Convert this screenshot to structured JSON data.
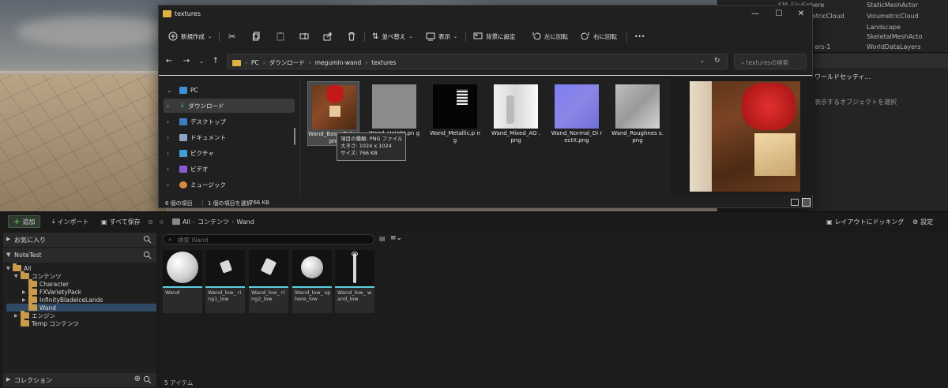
{
  "explorer": {
    "title": "textures",
    "commands": {
      "new": "新規作成",
      "sort": "並べ替え",
      "view": "表示",
      "set_background": "背景に設定",
      "rotate_left": "左に回転",
      "rotate_right": "右に回転",
      "more": "•••"
    },
    "path": [
      "PC",
      "ダウンロード",
      "megumin-wand",
      "textures"
    ],
    "search_placeholder": "texturesの検索",
    "nav_items": [
      {
        "label": "PC"
      },
      {
        "label": "ダウンロード"
      },
      {
        "label": "デスクトップ"
      },
      {
        "label": "ドキュメント"
      },
      {
        "label": "ピクチャ"
      },
      {
        "label": "ビデオ"
      },
      {
        "label": "ミュージック"
      }
    ],
    "files": [
      {
        "name": "Wand_Base_Color.png",
        "display": "Wand_Base_Colo r.png"
      },
      {
        "name": "Wand_Height.png",
        "display": "Wand_Height.pn g"
      },
      {
        "name": "Wand_Metallic.png",
        "display": "Wand_Metallic.p ng"
      },
      {
        "name": "Wand_Mixed_AO.png",
        "display": "Wand_Mixed_AO .png"
      },
      {
        "name": "Wand_Normal_DirectX.png",
        "display": "Wand_Normal_Di rectX.png"
      },
      {
        "name": "Wand_Roughness.png",
        "display": "Wand_Roughnes s.png"
      }
    ],
    "tooltip": {
      "type": "項目の種類: PNG ファイル",
      "size": "大きさ: 1024 x 1024",
      "filesize": "サイズ: 766 KB"
    },
    "status": {
      "count": "6 個の項目",
      "selected": "1 個の項目を選択",
      "size": "766 KB"
    }
  },
  "outliner": {
    "rows_left": [
      "SM_SkySphere",
      "VolumetricCloud",
      "ers-1"
    ],
    "rows_right": [
      "StaticMeshActor",
      "VolumetricCloud",
      "Landscape",
      "SkeletalMeshActo",
      "WorldDataLayers"
    ],
    "details_header": "ワールドセッティ...",
    "hint": "表示するオブジェクトを選択"
  },
  "content_browser": {
    "add": "追加",
    "import": "インポート",
    "save_all": "すべて保存",
    "breadcrumb": [
      "All",
      "コンテンツ",
      "Wand"
    ],
    "dock": "レイアウトにドッキング",
    "settings": "設定",
    "favorites": "お気に入り",
    "project": "NoteTest",
    "tree": [
      {
        "label": "All"
      },
      {
        "label": "コンテンツ"
      },
      {
        "label": "Character"
      },
      {
        "label": "FXVarietyPack"
      },
      {
        "label": "InfinityBladeIceLands"
      },
      {
        "label": "Wand"
      },
      {
        "label": "エンジン"
      },
      {
        "label": "Temp コンテンツ"
      }
    ],
    "search_placeholder": "検索 Wand",
    "assets": [
      {
        "name": "Wand"
      },
      {
        "name": "Wand_low_ ring1_low"
      },
      {
        "name": "Wand_low_ ring2_low"
      },
      {
        "name": "Wand_low_ sphere_low"
      },
      {
        "name": "Wand_low_ wand_low"
      }
    ],
    "collections": "コレクション",
    "item_count": "5 アイテム"
  },
  "colors": {
    "accent": "#5dd0e0",
    "folder": "#c99a4a",
    "selection": "#2f4a66"
  }
}
